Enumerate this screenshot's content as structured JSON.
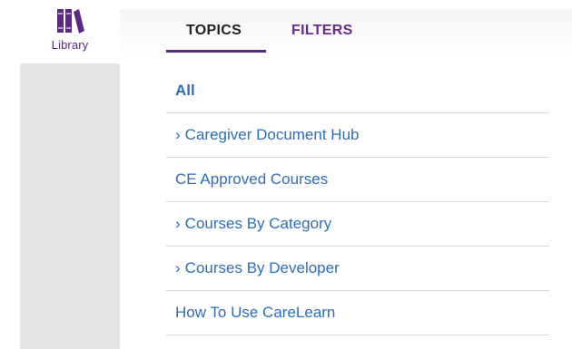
{
  "nav": {
    "library_label": "Library",
    "library_icon": "books-icon",
    "accent_color": "#5a2a82"
  },
  "tabs": [
    {
      "label": "TOPICS",
      "active": true
    },
    {
      "label": "FILTERS",
      "active": false
    }
  ],
  "topics": [
    {
      "label": "All",
      "expandable": false,
      "selected": true
    },
    {
      "label": "Caregiver Document Hub",
      "expandable": true,
      "selected": false
    },
    {
      "label": "CE Approved Courses",
      "expandable": false,
      "selected": false
    },
    {
      "label": "Courses By Category",
      "expandable": true,
      "selected": false
    },
    {
      "label": "Courses By Developer",
      "expandable": true,
      "selected": false
    },
    {
      "label": "How To Use CareLearn",
      "expandable": false,
      "selected": false
    }
  ],
  "colors": {
    "link": "#2f6db5",
    "divider": "#d9d9d9",
    "rail": "#e6e6e6"
  }
}
